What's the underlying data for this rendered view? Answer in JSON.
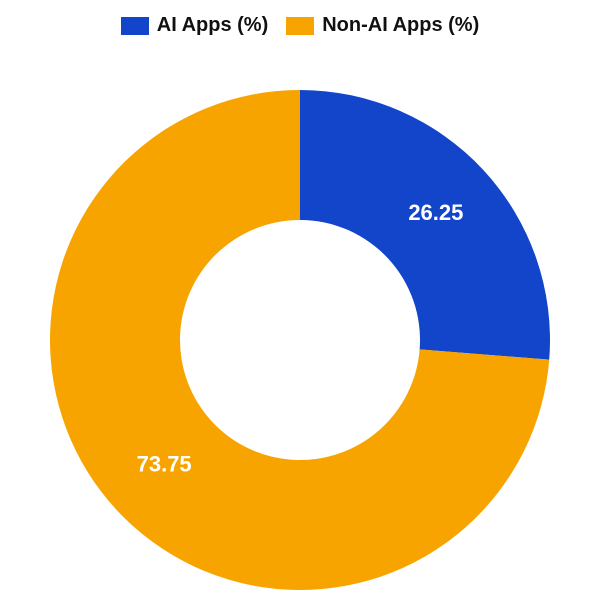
{
  "legend": {
    "items": [
      {
        "label": "AI Apps (%)",
        "color": "#1245c9"
      },
      {
        "label": "Non-AI Apps (%)",
        "color": "#f7a400"
      }
    ]
  },
  "chart_data": {
    "type": "pie",
    "title": "",
    "slices": [
      {
        "name": "AI Apps (%)",
        "value": 26.25,
        "color": "#1245c9"
      },
      {
        "name": "Non-AI Apps (%)",
        "value": 73.75,
        "color": "#f7a400"
      }
    ],
    "inner_radius_ratio": 0.48,
    "data_labels": [
      "26.25",
      "73.75"
    ]
  }
}
